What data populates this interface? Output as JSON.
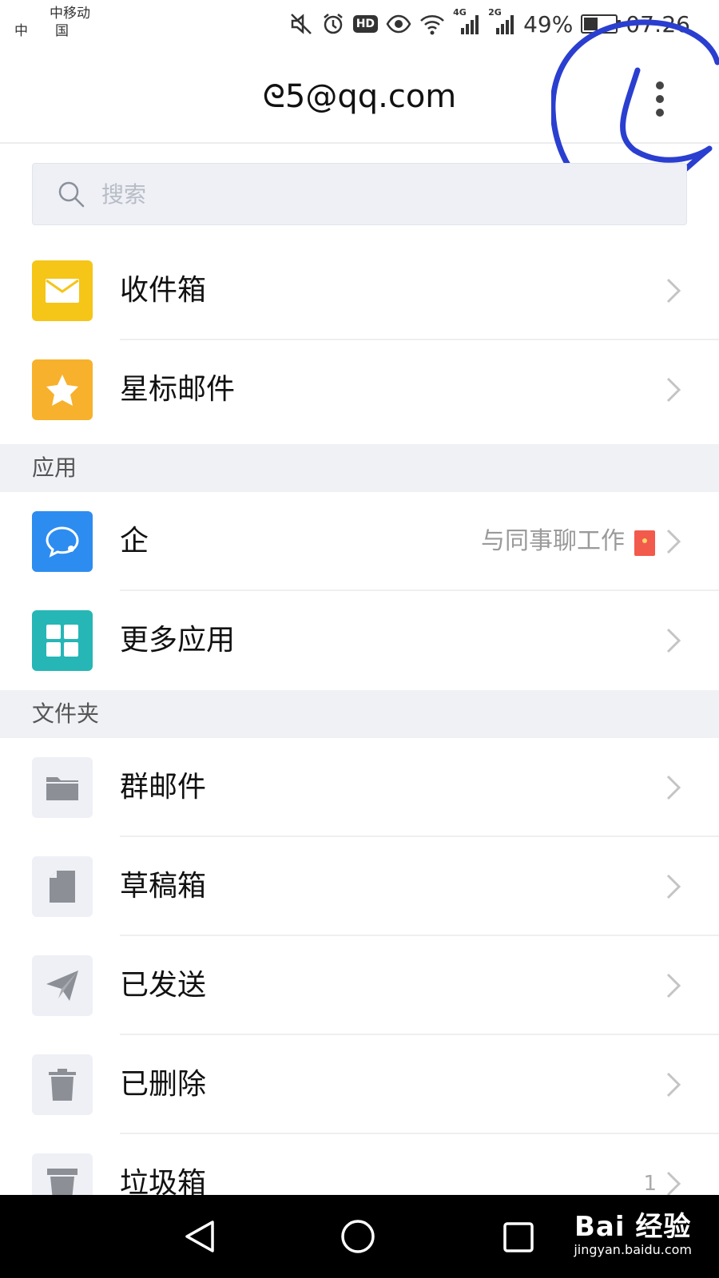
{
  "status_bar": {
    "carrier_line1": "中移动",
    "carrier_line2": "中国",
    "battery": "49%",
    "time": "07:26",
    "network_1": "4G",
    "network_2": "2G"
  },
  "header": {
    "title": "ᘓ5@qq.com"
  },
  "search": {
    "placeholder": "搜索"
  },
  "mailboxes": [
    {
      "label": "收件箱",
      "icon": "envelope-icon",
      "color": "#f5c518"
    },
    {
      "label": "星标邮件",
      "icon": "star-icon",
      "color": "#f7b12c"
    }
  ],
  "sections": {
    "apps": "应用",
    "folders": "文件夹"
  },
  "apps": [
    {
      "label": "企",
      "icon": "chat-bubble-icon",
      "color": "#2d8cf0",
      "side_text": "与同事聊工作"
    },
    {
      "label": "更多应用",
      "icon": "grid-icon",
      "color": "#26b6b6"
    }
  ],
  "folders": [
    {
      "label": "群邮件",
      "icon": "folder-icon"
    },
    {
      "label": "草稿箱",
      "icon": "draft-icon"
    },
    {
      "label": "已发送",
      "icon": "paper-plane-icon"
    },
    {
      "label": "已删除",
      "icon": "trash-icon"
    },
    {
      "label": "垃圾箱",
      "icon": "spam-bin-icon",
      "count": "1"
    }
  ],
  "nav": {
    "watermark_main": "Bai 经验",
    "watermark_sub": "jingyan.baidu.com"
  },
  "colors": {
    "folder_icon_bg": "#eef0f5",
    "folder_icon_fg": "#8c8f96",
    "annotation": "#2a3fd0"
  }
}
